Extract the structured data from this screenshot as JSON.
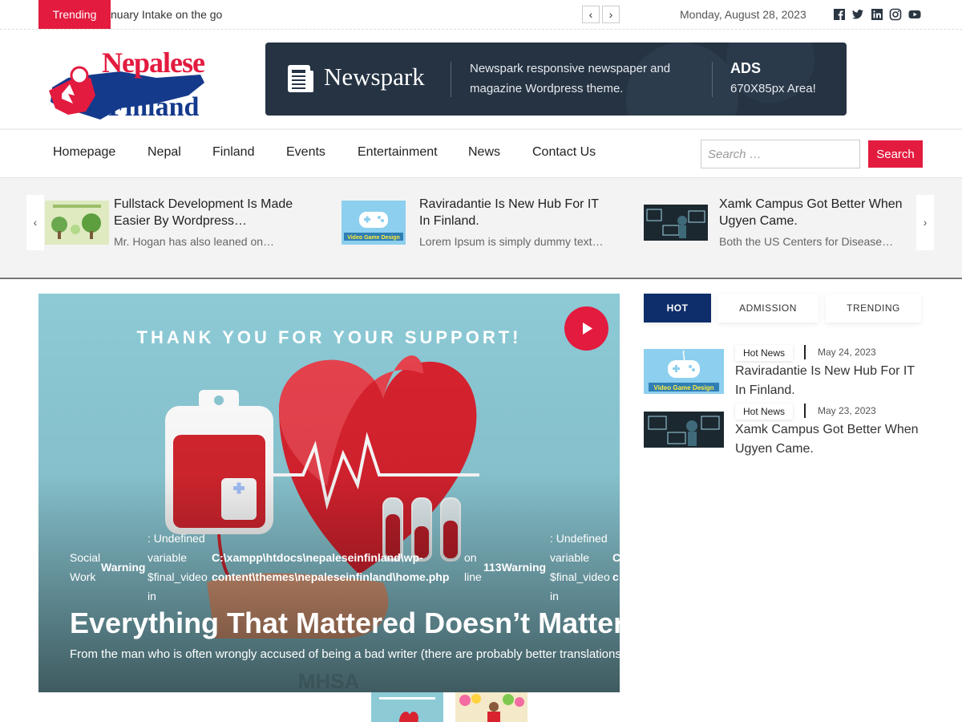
{
  "topbar": {
    "trending_label": "Trending",
    "ticker_text": "nuary Intake on the go",
    "prev_arrow": "‹",
    "next_arrow": "›",
    "date": "Monday, August 28, 2023",
    "social_icons": [
      "facebook-icon",
      "twitter-icon",
      "linkedin-icon",
      "instagram-icon",
      "youtube-icon"
    ]
  },
  "logo": {
    "line1": "Nepalese",
    "line2": "In",
    "line3": "Finland"
  },
  "ad": {
    "brand": "Newspark",
    "description": "Newspark responsive newspaper and magazine Wordpress theme.",
    "label": "ADS",
    "size": "670X85px Area!"
  },
  "nav": {
    "items": [
      "Homepage",
      "Nepal",
      "Finland",
      "Events",
      "Entertainment",
      "News",
      "Contact Us"
    ],
    "search_placeholder": "Search …",
    "search_button": "Search"
  },
  "strip": {
    "prev_arrow": "‹",
    "next_arrow": "›",
    "cards": [
      {
        "title": "Fullstack Development Is Made Easier By Wordpress…",
        "excerpt": "Mr. Hogan has also leaned on…"
      },
      {
        "title": "Raviradantie Is New Hub For IT In Finland.",
        "excerpt": "Lorem Ipsum is simply dummy text…"
      },
      {
        "title": "Xamk Campus Got Better When Ugyen Came.",
        "excerpt": "Both the US Centers for Disease…"
      }
    ]
  },
  "hero": {
    "banner_text": "THANK YOU FOR YOUR SUPPORT!",
    "watermark": "MHSA",
    "category": [
      "Social",
      "Work"
    ],
    "warning_1": "Warning",
    "undefined_1": [
      ": Undefined",
      "variable",
      "$final_video",
      "in"
    ],
    "path": [
      "C:\\xampp\\htdocs\\nepaleseinfinland\\wp-",
      "content\\themes\\nepaleseinfinland\\home.php"
    ],
    "on_line": [
      "on",
      "line"
    ],
    "line_warning": "113Warning",
    "undefined_2": [
      ": Undefined",
      "variable",
      "$final_video",
      "in"
    ],
    "trailing": [
      "C",
      "c"
    ],
    "title": "Everything That Mattered Doesn’t Matter",
    "excerpt": "From the man who is often wrongly accused of being a bad writer (there are probably better translations"
  },
  "sidebar": {
    "tabs": [
      "HOT",
      "ADMISSION",
      "TRENDING"
    ],
    "posts": [
      {
        "category": "Hot News",
        "date": "May 24, 2023",
        "title": "Raviradantie Is New Hub For IT In Finland."
      },
      {
        "category": "Hot News",
        "date": "May 23, 2023",
        "title": "Xamk Campus Got Better When Ugyen Came."
      }
    ],
    "thumb_caption": "Video Game Design"
  },
  "colors": {
    "accent": "#e31b3f",
    "navy": "#0e2d6b",
    "ad_bg": "#253343"
  }
}
